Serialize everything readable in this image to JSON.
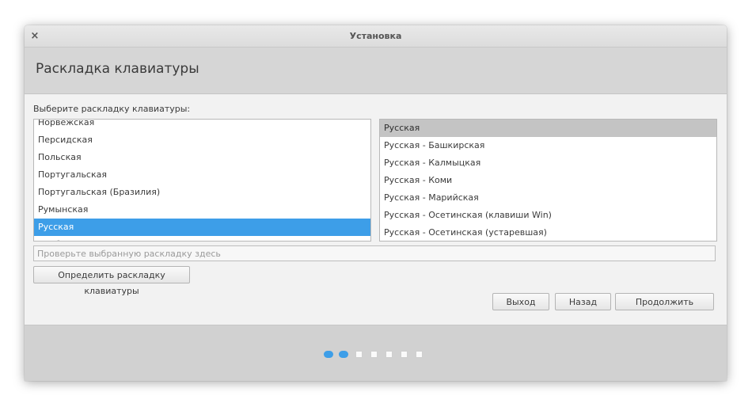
{
  "window": {
    "title": "Установка",
    "close_symbol": "×"
  },
  "header": {
    "title": "Раскладка клавиатуры"
  },
  "layout_prompt": "Выберите раскладку клавиатуры:",
  "layouts": [
    "Норвежская",
    "Персидская",
    "Польская",
    "Португальская",
    "Португальская (Бразилия)",
    "Румынская",
    "Русская",
    "Сербская"
  ],
  "selected_layout": "Русская",
  "variants": [
    "Русская",
    "Русская - Башкирская",
    "Русская - Калмыцкая",
    "Русская - Коми",
    "Русская - Марийская",
    "Русская - Осетинская (клавиши Win)",
    "Русская - Осетинская (устаревшая)"
  ],
  "selected_variant": "Русская",
  "test_input": {
    "placeholder": "Проверьте выбранную раскладку здесь",
    "value": ""
  },
  "buttons": {
    "detect": "Определить раскладку клавиатуры",
    "exit": "Выход",
    "back": "Назад",
    "continue": "Продолжить"
  },
  "progress": {
    "completed_steps": 2,
    "total_steps": 7
  },
  "colors": {
    "selection": "#3d9ee8",
    "selection_inactive": "#c4c4c4",
    "header_bg": "#d6d6d6",
    "footer_bg": "#d1d1d1"
  }
}
